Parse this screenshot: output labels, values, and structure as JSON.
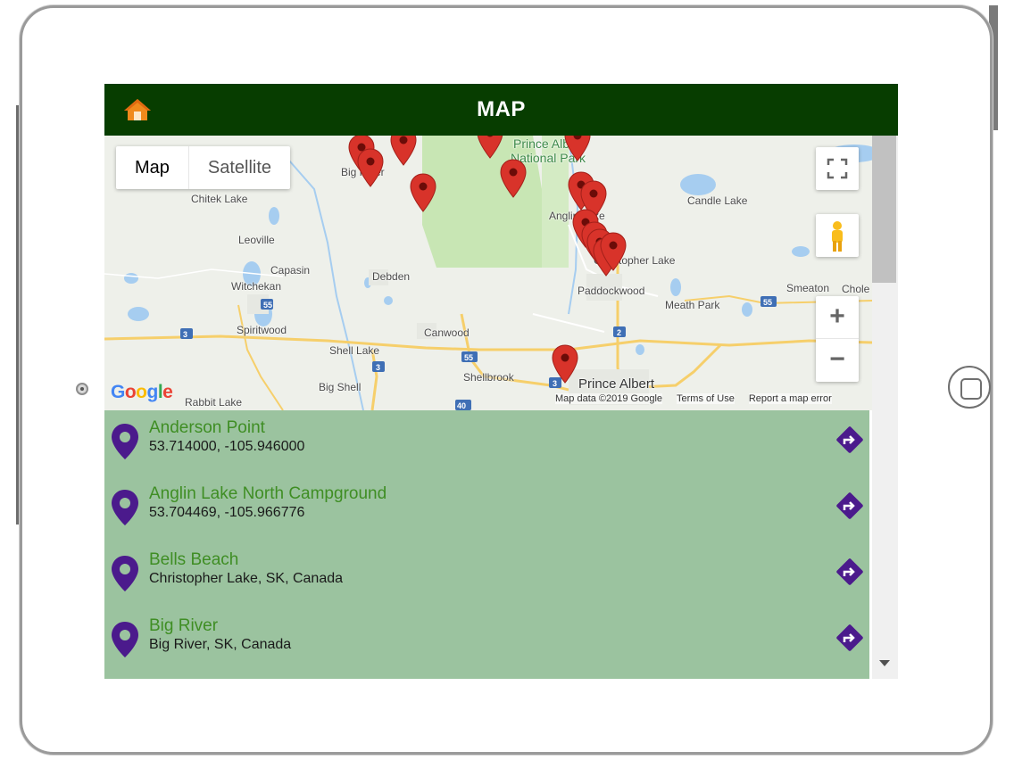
{
  "header": {
    "title": "MAP",
    "home_icon": "home-icon"
  },
  "map": {
    "type_control": {
      "map_label": "Map",
      "satellite_label": "Satellite",
      "selected": "Map"
    },
    "places": [
      {
        "name": "Chitek Lake",
        "cls": ""
      },
      {
        "name": "Leoville",
        "cls": ""
      },
      {
        "name": "Capasin",
        "cls": ""
      },
      {
        "name": "Witchekan",
        "cls": ""
      },
      {
        "name": "Spiritwood",
        "cls": ""
      },
      {
        "name": "Debden",
        "cls": ""
      },
      {
        "name": "Canwood",
        "cls": ""
      },
      {
        "name": "Shell Lake",
        "cls": ""
      },
      {
        "name": "Big Shell",
        "cls": ""
      },
      {
        "name": "Shellbrook",
        "cls": ""
      },
      {
        "name": "Rabbit Lake",
        "cls": ""
      },
      {
        "name": "Big River",
        "cls": ""
      },
      {
        "name": "Prince Albert",
        "cls": ""
      },
      {
        "name": "National Park",
        "cls": ""
      },
      {
        "name": "Anglin Lake",
        "cls": ""
      },
      {
        "name": "Christopher Lake",
        "cls": ""
      },
      {
        "name": "Paddockwood",
        "cls": ""
      },
      {
        "name": "Meath Park",
        "cls": ""
      },
      {
        "name": "Candle Lake",
        "cls": ""
      },
      {
        "name": "Smeaton",
        "cls": ""
      },
      {
        "name": "Chole",
        "cls": ""
      },
      {
        "name": "Prince Albert",
        "cls": "big"
      }
    ],
    "highway_shields": [
      "3",
      "3",
      "55",
      "55",
      "2",
      "3",
      "40",
      "3"
    ],
    "google_logo": "Google",
    "attribution": {
      "data": "Map data ©2019 Google",
      "terms": "Terms of Use",
      "report": "Report a map error"
    },
    "marker_color": "#d8332a",
    "marker_count": 15
  },
  "locations": [
    {
      "name": "Anderson Point",
      "detail": "53.714000, -105.946000"
    },
    {
      "name": "Anglin Lake North Campground",
      "detail": "53.704469, -105.966776"
    },
    {
      "name": "Bells Beach",
      "detail": "Christopher Lake, SK, Canada"
    },
    {
      "name": "Big River",
      "detail": "Big River, SK, Canada"
    }
  ],
  "colors": {
    "header_bg": "#073d00",
    "list_bg": "#9bc39f",
    "location_name": "#3f8e24",
    "icon_purple": "#4b1a8c",
    "home_orange": "#f08a1c"
  }
}
